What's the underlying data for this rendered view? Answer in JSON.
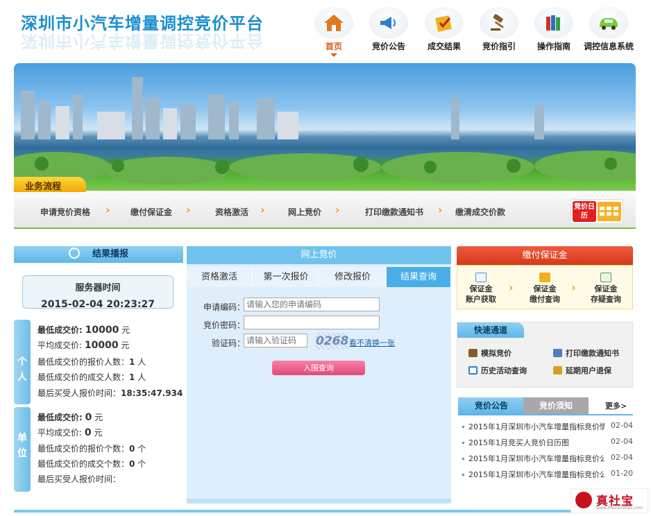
{
  "header": {
    "title": "深圳市小汽车增量调控竞价平台",
    "nav": [
      {
        "label": "首页",
        "icon": "house-icon",
        "active": true
      },
      {
        "label": "竞价公告",
        "icon": "megaphone-icon"
      },
      {
        "label": "成交结果",
        "icon": "check-notepad-icon"
      },
      {
        "label": "竞价指引",
        "icon": "gavel-icon"
      },
      {
        "label": "操作指南",
        "icon": "books-icon"
      },
      {
        "label": "调控信息系统",
        "icon": "green-car-icon"
      }
    ]
  },
  "flow": {
    "tag": "业务流程",
    "steps": [
      "申请竞价资格",
      "缴付保证金",
      "资格激活",
      "网上竞价",
      "打印缴款通知书",
      "缴清成交价款"
    ],
    "calendar_label": "竞价日历"
  },
  "result": {
    "title": "结果播报",
    "server_time_label": "服务器时间",
    "server_time": "2015-02-04 20:23:27",
    "personal": {
      "tab": "个人",
      "lowest_price_label": "最低成交价:",
      "lowest_price": "10000",
      "avg_price_label": "平均成交价:",
      "avg_price": "10000",
      "unit": "元",
      "bidders_label": "最低成交价的报价人数：",
      "bidders": "1",
      "winners_label": "最低成交价的成交人数：",
      "winners": "1",
      "people_unit": "人",
      "last_time_label": "最后买受人报价时间：",
      "last_time": "18:35:47.934"
    },
    "company": {
      "tab": "单位",
      "lowest_price_label": "最低成交价:",
      "lowest_price": "0",
      "avg_price_label": "平均成交价:",
      "avg_price": "0",
      "unit": "元",
      "bidders_label": "最低成交价的报价个数：",
      "bidders": "0",
      "winners_label": "最低成交价的成交个数：",
      "winners": "0",
      "count_unit": "个",
      "last_time_label": "最后买受人报价时间："
    }
  },
  "online": {
    "title": "网上竞价",
    "tabs": [
      "资格激活",
      "第一次报价",
      "修改报价",
      "结果查询"
    ],
    "active_tab": 3,
    "apply_code_label": "申请编码：",
    "apply_code_placeholder": "请输入您的申请编码",
    "password_label": "竞价密码：",
    "password_value": "",
    "captcha_label": "验证码：",
    "captcha_placeholder": "请输入验证码",
    "captcha_text": "0268",
    "refresh_link": "看不清换一张",
    "submit": "入围查询"
  },
  "deposit": {
    "title": "缴付保证金",
    "items": [
      {
        "line1": "保证金",
        "line2": "账户获取",
        "icon": "search-doc-icon"
      },
      {
        "line1": "保证金",
        "line2": "缴付查询",
        "icon": "coin-doc-icon"
      },
      {
        "line1": "保证金",
        "line2": "存疑查询",
        "icon": "car-doc-icon"
      }
    ]
  },
  "quick": {
    "title": "快速通道",
    "items": [
      {
        "label": "模拟竞价",
        "icon": "gavel-icon"
      },
      {
        "label": "打印缴款通知书",
        "icon": "printer-icon"
      },
      {
        "label": "历史活动查询",
        "icon": "calendar-icon"
      },
      {
        "label": "延期用户退保",
        "icon": "clipboard-icon"
      }
    ]
  },
  "news": {
    "tabs": [
      "竞价公告",
      "竞价须知"
    ],
    "more": "更多>",
    "items": [
      {
        "title": "2015年1月深圳市小汽车增量指标竞价情",
        "date": "02-04"
      },
      {
        "title": "2015年1月竞买人竞价日历图",
        "date": "02-04"
      },
      {
        "title": "2015年1月深圳市小汽车增量指标竞价公",
        "date": "02-04"
      },
      {
        "title": "2015年1月深圳市小汽车增量指标竞价公",
        "date": "01-20"
      }
    ]
  },
  "watermark": {
    "brand": "真社宝",
    "url": "www.zhenshebao.com"
  },
  "colors": {
    "accent_blue": "#1a8fd0",
    "active_orange": "#e05a10",
    "tab_active": "#49aee8",
    "deposit_red": "#d43a1a"
  }
}
